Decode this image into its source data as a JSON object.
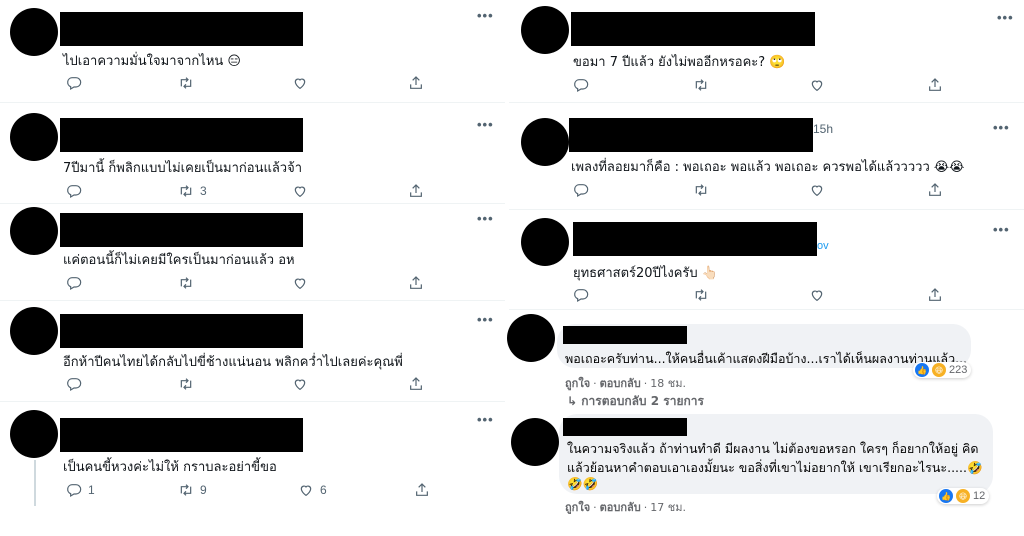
{
  "left_tweets": [
    {
      "text": "ไปเอาความมั่นใจมาจากไหน",
      "emoji": "😑",
      "replies": "",
      "retweets": "",
      "likes": ""
    },
    {
      "text": "7ปีมานี้ ก็พลิกแบบไม่เคยเป็นมาก่อนแล้วจ้า",
      "emoji": "",
      "replies": "",
      "retweets": "3",
      "likes": ""
    },
    {
      "text": "แค่ตอนนี้ก็ไม่เคยมีใครเป็นมาก่อนแล้ว อห",
      "emoji": "",
      "replies": "",
      "retweets": "",
      "likes": ""
    },
    {
      "text": "อีกห้าปีคนไทยได้กลับไปขี่ช้างแน่นอน พลิกคว่ำไปเลยค่ะคุณพี่",
      "emoji": "",
      "replies": "",
      "retweets": "",
      "likes": ""
    },
    {
      "text": "เป็นคนขี้หวงค่ะไม่ให้  กราบละอย่าขี้ขอ",
      "emoji": "",
      "replies": "1",
      "retweets": "9",
      "likes": "6"
    }
  ],
  "right_tweets": [
    {
      "text": "ขอมา 7 ปีแล้ว ยังไม่พออีกหรอคะ?",
      "emoji": "🙄",
      "timestamp": "",
      "link_fragment": "",
      "retweets": ""
    },
    {
      "text": "เพลงที่ลอยมาก็คือ : พอเถอะ พอแล้ว พอเถอะ ควรพอได้แล้ววววว",
      "emoji": "😭😭",
      "timestamp": "15h",
      "link_fragment": "",
      "retweets": ""
    },
    {
      "text": "ยุทธศาสตร์20ปีไงครับ",
      "emoji": "👆🏻",
      "timestamp": "",
      "link_fragment": "ov",
      "retweets": ""
    }
  ],
  "fb_comments": [
    {
      "lines": [
        "พอเถอะครับท่าน...ให้คนอื่นเค้าแสดงฝีมือบ้าง...เราได้เห็นผลงานท่านแล้ว..."
      ],
      "like_label": "ถูกใจ",
      "reply_label": "ตอบกลับ",
      "time": "18 ชม.",
      "reaction_count": "223",
      "replies_link": "การตอบกลับ 2 รายการ"
    },
    {
      "lines": [
        "ในความจริงแล้ว ถ้าท่านทำดี มีผลงาน ไม่ต้องขอหรอก ใครๆ ก็อยากให้อยู่ คิด",
        "แล้วย้อนหาคำตอบเอาเองมั้ยนะ ขอสิ่งที่เขาไม่อยากให้ เขาเรียกอะไรนะ.....🤣",
        "🤣🤣"
      ],
      "like_label": "ถูกใจ",
      "reply_label": "ตอบกลับ",
      "time": "17 ชม.",
      "reaction_count": "12",
      "replies_link": ""
    }
  ],
  "icons": {
    "more": "more-horizontal-icon",
    "reply": "reply-bubble-icon",
    "retweet": "retweet-icon",
    "like": "heart-icon",
    "share": "share-upload-icon",
    "fb_like": "thumbs-up-icon",
    "fb_haha": "laughing-face-icon",
    "replies_arrow": "reply-arrow-icon"
  },
  "colors": {
    "twitter_gray": "#536471",
    "twitter_blue": "#1d9bf0",
    "fb_bubble": "#f0f2f5",
    "fb_like": "#1877f2",
    "fb_haha": "#f7b125"
  }
}
